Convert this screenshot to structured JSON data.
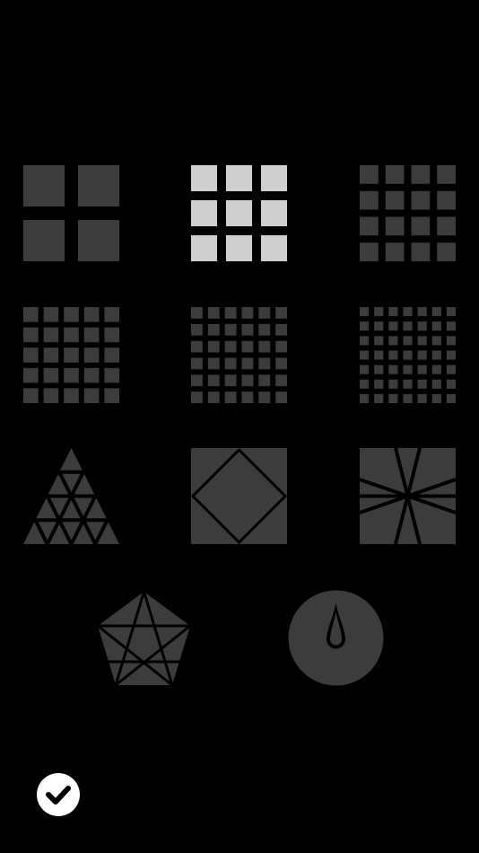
{
  "colors": {
    "background": "#000000",
    "tile": "#3c3c3c",
    "tile_selected": "#cfcfcf",
    "confirm_bg": "#ffffff",
    "confirm_icon": "#000000"
  },
  "selected_index": 1,
  "tiles": [
    {
      "shape": "grid",
      "size": 2
    },
    {
      "shape": "grid",
      "size": 3
    },
    {
      "shape": "grid",
      "size": 4
    },
    {
      "shape": "grid",
      "size": 5
    },
    {
      "shape": "grid",
      "size": 6
    },
    {
      "shape": "grid",
      "size": 7
    },
    {
      "shape": "triangle-icon"
    },
    {
      "shape": "diamond-icon"
    },
    {
      "shape": "radial-icon"
    },
    {
      "shape": "pentagon-icon"
    },
    {
      "shape": "dial-icon"
    }
  ],
  "confirm": {
    "icon": "checkmark-icon"
  }
}
